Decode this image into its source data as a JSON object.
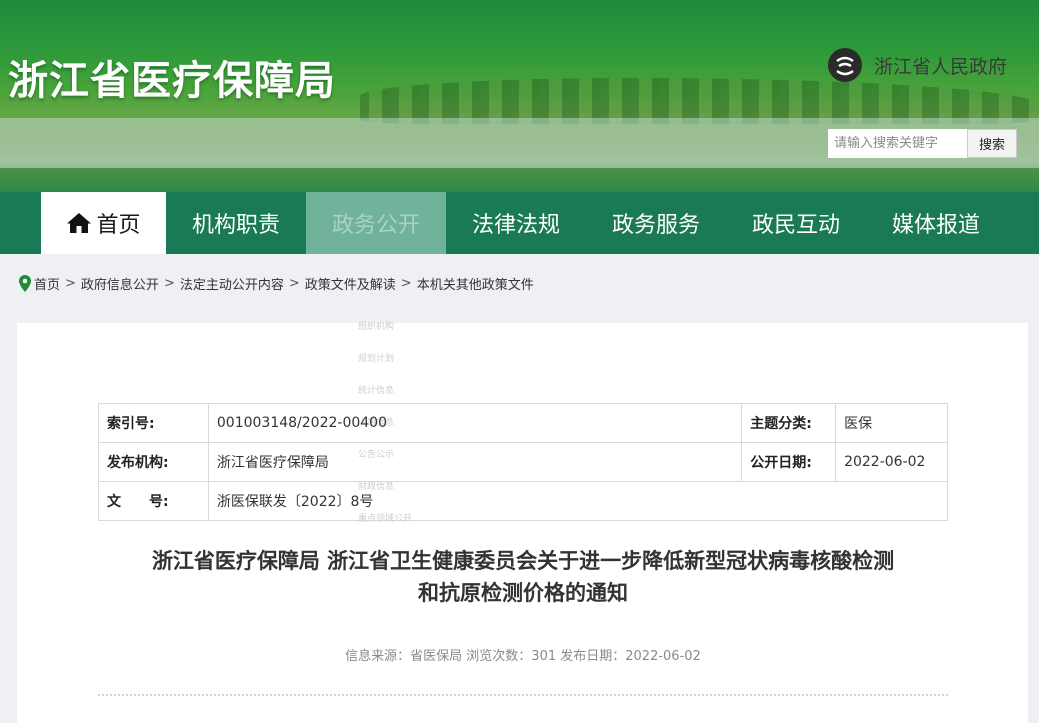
{
  "header": {
    "site_title": "浙江省医疗保障局",
    "gov_link_label": "浙江省人民政府",
    "search_placeholder": "请输入搜索关键字",
    "search_button": "搜索"
  },
  "nav": {
    "items": [
      {
        "label": "首页",
        "active": true
      },
      {
        "label": "机构职责"
      },
      {
        "label": "政务公开",
        "highlighted": true
      },
      {
        "label": "法律法规"
      },
      {
        "label": "政务服务"
      },
      {
        "label": "政民互动"
      },
      {
        "label": "媒体报道"
      }
    ],
    "dropdown_items": [
      "组织机构",
      "规划计划",
      "统计信息",
      "人事信息",
      "公告公示",
      "财政信息",
      "重点领域公开"
    ]
  },
  "breadcrumb": [
    "首页",
    "政府信息公开",
    "法定主动公开内容",
    "政策文件及解读",
    "本机关其他政策文件"
  ],
  "meta": {
    "index_label": "索引号:",
    "index_value": "001003148/2022-00400",
    "topic_label": "主题分类:",
    "topic_value": "医保",
    "publisher_label": "发布机构:",
    "publisher_value": "浙江省医疗保障局",
    "open_date_label": "公开日期:",
    "open_date_value": "2022-06-02",
    "doc_no_label": "文　　号:",
    "doc_no_value": "浙医保联发〔2022〕8号"
  },
  "document": {
    "title_line1": "浙江省医疗保障局 浙江省卫生健康委员会关于进一步降低新型冠状病毒核酸检测",
    "title_line2": "和抗原检测价格的通知",
    "info_line": "信息来源：省医保局 浏览次数：301 发布日期：2022-06-02"
  },
  "colors": {
    "nav_bg": "#197a55",
    "nav_highlight": "#71b29b",
    "page_bg": "#eef0f3"
  }
}
